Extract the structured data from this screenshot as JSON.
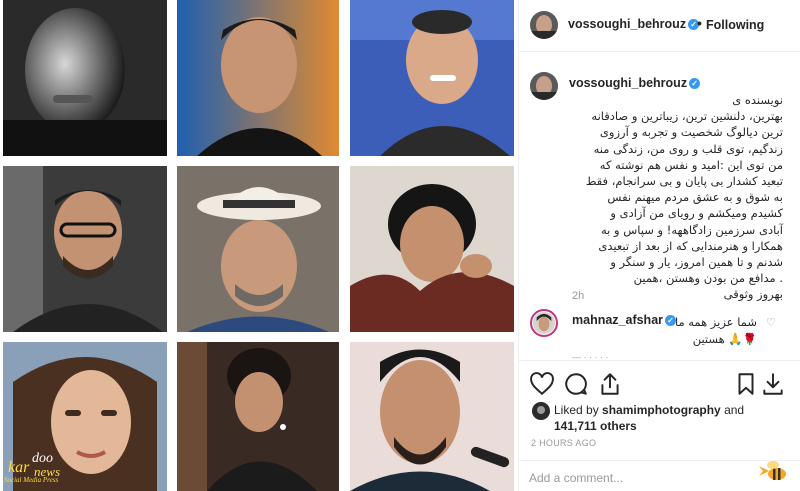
{
  "post": {
    "username": "vossoughi_behrouz",
    "follow_status": "Following",
    "caption_text": "نویسنده ی\nبهترین، دلنشین ترین، زیباترین و صادقانه\nترین دیالوگ شخصیت و تجربه و آرزوی\nزندگیم، توی قلب و روی من، زندگی منه\nمن توی این :امید و نفس هم نوشته که\nتبعید کشدار بی پایان و بی سرانجام، فقط\nبه شوق و به عشق مردم میهنم نفس\nکشیدم ومیکشم و رویای من آزادی و\nآبادی سرزمین زادگاههه! و سپاس و به\nهمکارا و هنرمندایی که از بعد از تبعیدی\nشدنم و تا همین امروز، یار و سنگر و\n. مدافع من بودن وهستن ،همین\nبهروز وثوقی",
    "caption_time": "2h",
    "comment": {
      "username": "mahnaz_afshar",
      "text": "شما عزیز همه ما\n🌹🙏 هستین"
    },
    "likes": {
      "prefix": "Liked by",
      "user": "shamimphotography",
      "connector": "and",
      "count": "141,711 others"
    },
    "time_ago": "2 HOURS AGO",
    "add_comment_placeholder": "Add a comment..."
  },
  "watermark": {
    "logo": "kardoo news",
    "tagline": "Social Media Press"
  },
  "icons": {
    "verified": "verified-badge-icon",
    "like": "heart-outline-icon",
    "comment": "speech-bubble-icon",
    "share": "share-arrow-icon",
    "save": "bookmark-icon",
    "download": "download-arrow-icon",
    "comment_like": "small-heart-icon",
    "bee": "bee-logo-icon"
  },
  "colors": {
    "verified_blue": "#3897f0",
    "story_ring": "#c13584",
    "muted_text": "#999999",
    "watermark_yellow": "#ffda44"
  }
}
